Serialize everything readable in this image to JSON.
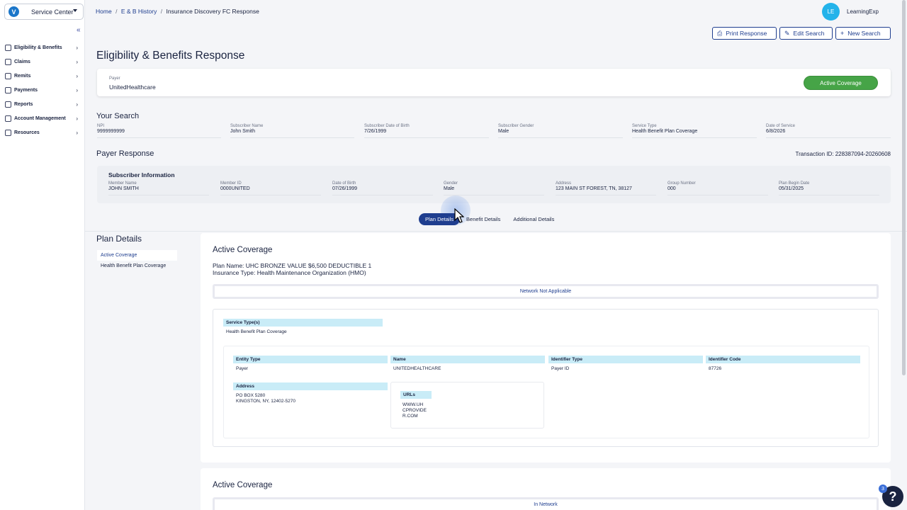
{
  "app": {
    "service_center": "Service Center",
    "logo_letter": "V",
    "collapse": "«"
  },
  "sidebar": {
    "items": [
      {
        "label": "Eligibility & Benefits"
      },
      {
        "label": "Claims"
      },
      {
        "label": "Remits"
      },
      {
        "label": "Payments"
      },
      {
        "label": "Reports"
      },
      {
        "label": "Account Management"
      },
      {
        "label": "Resources"
      }
    ]
  },
  "breadcrumb": {
    "home": "Home",
    "history": "E & B History",
    "current": "Insurance Discovery FC Response",
    "sep": "/"
  },
  "user": {
    "initials": "LE",
    "name": "LearningExp"
  },
  "actions": {
    "print": "Print Response",
    "edit": "Edit Search",
    "new": "New Search"
  },
  "page_title": "Eligibility & Benefits Response",
  "payer": {
    "label": "Payer",
    "value": "UnitedHealthcare",
    "status": "Active Coverage"
  },
  "your_search": {
    "title": "Your Search",
    "fields": [
      {
        "label": "NPI",
        "value": "9999999999"
      },
      {
        "label": "Subscriber Name",
        "value": "John Smith"
      },
      {
        "label": "Subscriber Date of Birth",
        "value": "7/26/1999"
      },
      {
        "label": "Subscriber Gender",
        "value": "Male"
      },
      {
        "label": "Service Type",
        "value": "Health Benefit Plan Coverage"
      },
      {
        "label": "Date of Service",
        "value": "6/8/2026"
      }
    ]
  },
  "payer_response": {
    "title": "Payer Response",
    "transaction": "Transaction ID: 228387094-20260608",
    "subscriber_title": "Subscriber Information",
    "fields": [
      {
        "label": "Member Name",
        "value": "JOHN SMITH"
      },
      {
        "label": "Member ID",
        "value": "0000UNITED"
      },
      {
        "label": "Date of Birth",
        "value": "07/26/1999"
      },
      {
        "label": "Gender",
        "value": "Male"
      },
      {
        "label": "Address",
        "value": "123 MAIN ST FOREST, TN, 38127"
      },
      {
        "label": "Group Number",
        "value": "000"
      },
      {
        "label": "Plan Begin Date",
        "value": "05/31/2025"
      }
    ]
  },
  "tabs": [
    {
      "label": "Plan Details"
    },
    {
      "label": "Benefit Details"
    },
    {
      "label": "Additional Details"
    }
  ],
  "plan_details": {
    "title": "Plan Details",
    "nav": [
      {
        "label": "Active Coverage"
      },
      {
        "label": "Health Benefit Plan Coverage"
      }
    ]
  },
  "coverage1": {
    "title": "Active Coverage",
    "plan_name": "Plan Name: UHC BRONZE VALUE $6,500 DEDUCTIBLE 1",
    "insurance_type": "Insurance Type: Health Maintenance Organization (HMO)",
    "network": "Network Not Applicable",
    "service_types_label": "Service Type(s)",
    "service_types_value": "Health Benefit Plan Coverage",
    "entity": {
      "entity_type_label": "Entity Type",
      "entity_type": "Payer",
      "name_label": "Name",
      "name": "UNITEDHEALTHCARE",
      "identifier_type_label": "Identifier Type",
      "identifier_type": "Payer ID",
      "identifier_code_label": "Identifier Code",
      "identifier_code": "87726",
      "address_label": "Address",
      "address_line1": "PO BOX 5280",
      "address_line2": "KINGSTON, NY, 12402-5270",
      "urls_label": "URLs",
      "url_line1": "WWW.UH",
      "url_line2": "CPROVIDE",
      "url_line3": "R.COM"
    }
  },
  "coverage2": {
    "title": "Active Coverage",
    "network": "In Network"
  },
  "help": {
    "symbol": "?",
    "badge": "3"
  }
}
